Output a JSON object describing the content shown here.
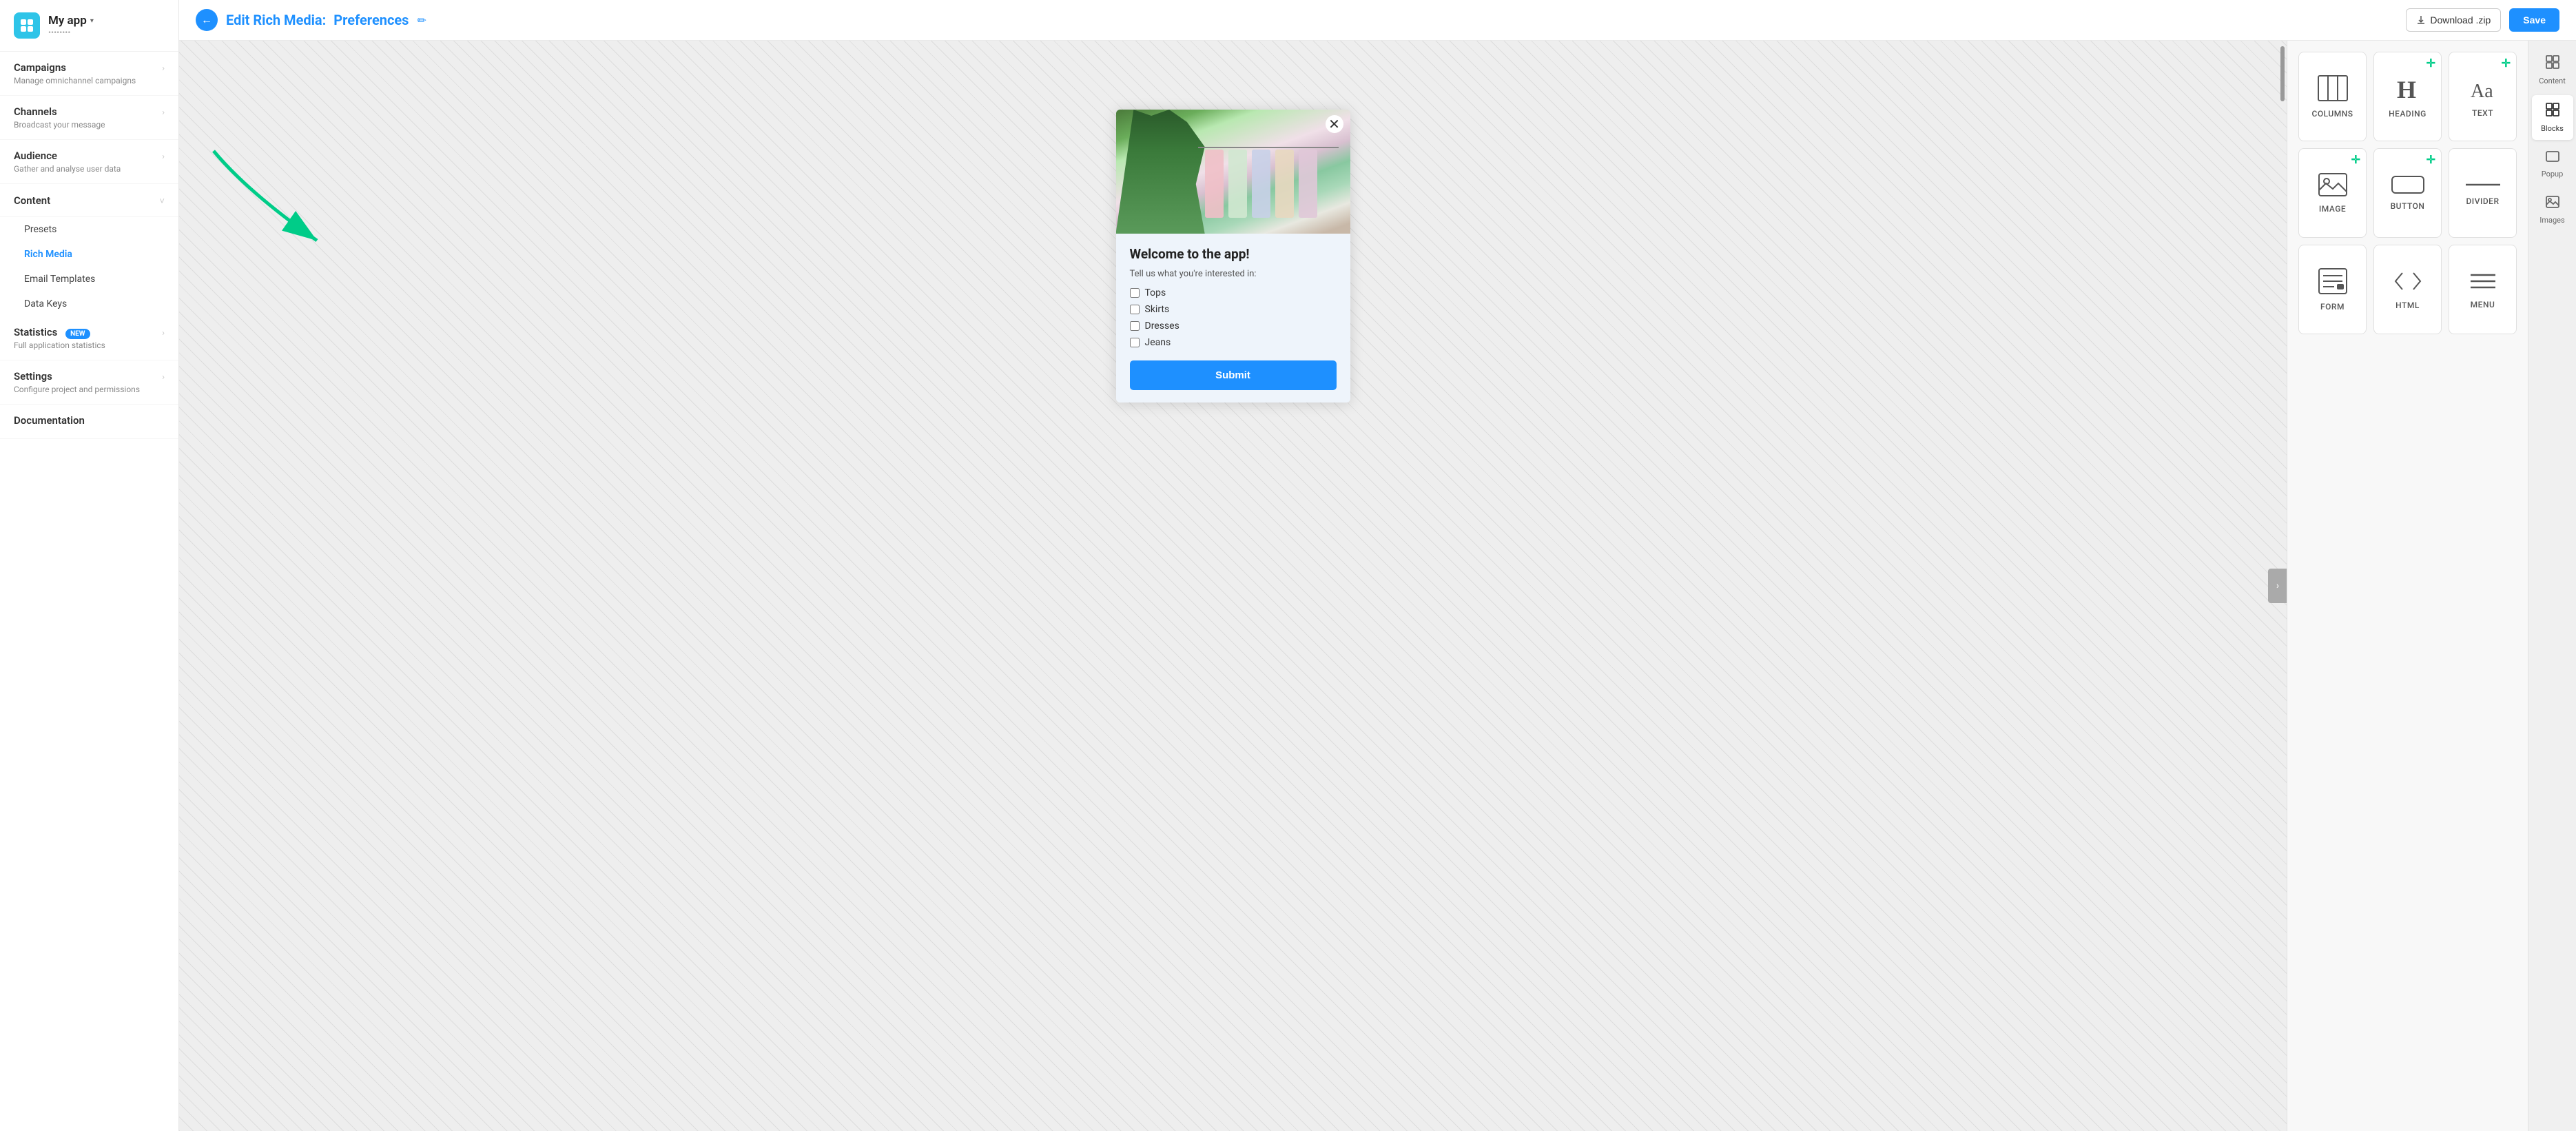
{
  "app": {
    "name": "My app",
    "subtitle": "••••••••",
    "icon_char": "✦"
  },
  "sidebar": {
    "items": [
      {
        "id": "campaigns",
        "title": "Campaigns",
        "sub": "Manage omnichannel campaigns",
        "has_arrow": true
      },
      {
        "id": "channels",
        "title": "Channels",
        "sub": "Broadcast your message",
        "has_arrow": true
      },
      {
        "id": "audience",
        "title": "Audience",
        "sub": "Gather and analyse user data",
        "has_arrow": true
      },
      {
        "id": "content",
        "title": "Content",
        "sub": "",
        "has_arrow": false,
        "expanded": true
      },
      {
        "id": "statistics",
        "title": "Statistics",
        "sub": "Full application statistics",
        "has_arrow": true,
        "badge": "NEW"
      },
      {
        "id": "settings",
        "title": "Settings",
        "sub": "Configure project and permissions",
        "has_arrow": true
      },
      {
        "id": "documentation",
        "title": "Documentation",
        "sub": "",
        "has_arrow": false
      }
    ],
    "content_sub_items": [
      {
        "id": "presets",
        "label": "Presets"
      },
      {
        "id": "rich-media",
        "label": "Rich Media",
        "active": true
      },
      {
        "id": "email-templates",
        "label": "Email Templates"
      },
      {
        "id": "data-keys",
        "label": "Data Keys"
      }
    ]
  },
  "topbar": {
    "page_label": "Edit Rich Media:",
    "page_name": "Preferences",
    "download_label": "Download .zip",
    "save_label": "Save"
  },
  "canvas": {
    "toggle_arrow": "❯"
  },
  "modal": {
    "close_char": "✕",
    "title": "Welcome to the app!",
    "subtitle": "Tell us what you're interested in:",
    "checkboxes": [
      "Tops",
      "Skirts",
      "Dresses",
      "Jeans"
    ],
    "submit_label": "Submit"
  },
  "blocks_panel": {
    "items": [
      {
        "id": "columns",
        "label": "COLUMNS",
        "icon": "columns",
        "has_plus": false
      },
      {
        "id": "heading",
        "label": "HEADING",
        "icon": "heading",
        "has_plus": true
      },
      {
        "id": "text",
        "label": "TEXT",
        "icon": "text",
        "has_plus": true
      },
      {
        "id": "image",
        "label": "IMAGE",
        "icon": "image",
        "has_plus": true
      },
      {
        "id": "button",
        "label": "BUTTON",
        "icon": "button",
        "has_plus": true
      },
      {
        "id": "divider",
        "label": "DIVIDER",
        "icon": "divider",
        "has_plus": false
      },
      {
        "id": "form",
        "label": "FORM",
        "icon": "form",
        "has_plus": false
      },
      {
        "id": "html",
        "label": "HTML",
        "icon": "html",
        "has_plus": false
      },
      {
        "id": "menu",
        "label": "MENU",
        "icon": "menu",
        "has_plus": false
      }
    ]
  },
  "side_tabs": [
    {
      "id": "content",
      "label": "Content",
      "icon": "☰",
      "active": false
    },
    {
      "id": "blocks",
      "label": "Blocks",
      "icon": "⊞",
      "active": true
    },
    {
      "id": "popup",
      "label": "Popup",
      "icon": "▭",
      "active": false
    },
    {
      "id": "images",
      "label": "Images",
      "icon": "🖼",
      "active": false
    }
  ]
}
